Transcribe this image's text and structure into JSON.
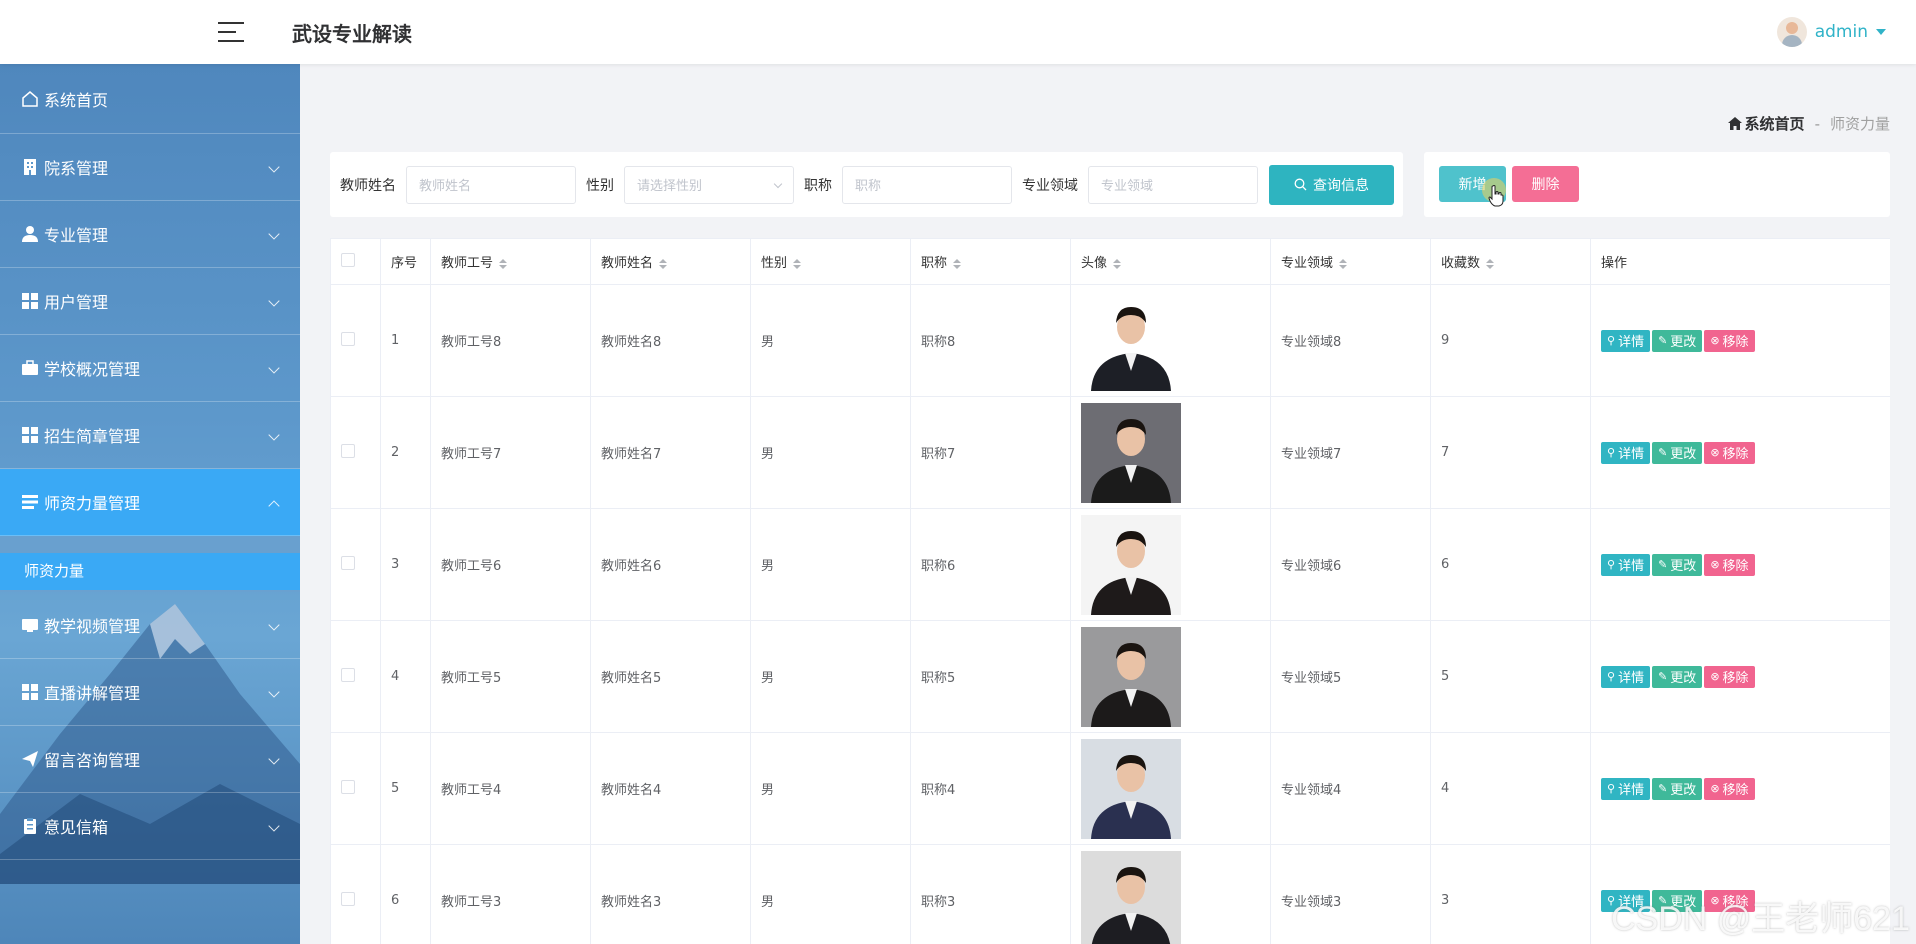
{
  "app": {
    "title": "武设专业解读"
  },
  "user": {
    "name": "admin"
  },
  "sidebar": {
    "items": [
      {
        "label": "系统首页",
        "icon": "home-icon",
        "expandable": false
      },
      {
        "label": "院系管理",
        "icon": "building-icon",
        "expandable": true
      },
      {
        "label": "专业管理",
        "icon": "user-icon",
        "expandable": true
      },
      {
        "label": "用户管理",
        "icon": "grid-icon",
        "expandable": true
      },
      {
        "label": "学校概况管理",
        "icon": "briefcase-icon",
        "expandable": true
      },
      {
        "label": "招生简章管理",
        "icon": "grid-icon",
        "expandable": true
      },
      {
        "label": "师资力量管理",
        "icon": "list-icon",
        "expandable": true,
        "active": true
      },
      {
        "label": "教学视频管理",
        "icon": "video-icon",
        "expandable": true
      },
      {
        "label": "直播讲解管理",
        "icon": "grid-icon",
        "expandable": true
      },
      {
        "label": "留言咨询管理",
        "icon": "send-icon",
        "expandable": true
      },
      {
        "label": "意见信箱",
        "icon": "clipboard-icon",
        "expandable": true
      }
    ],
    "submenu": {
      "label": "师资力量"
    }
  },
  "breadcrumb": {
    "home": "系统首页",
    "separator": "-",
    "current": "师资力量"
  },
  "search": {
    "teacher_name_label": "教师姓名",
    "teacher_name_placeholder": "教师姓名",
    "gender_label": "性别",
    "gender_placeholder": "请选择性别",
    "title_label": "职称",
    "title_placeholder": "职称",
    "field_label": "专业领域",
    "field_placeholder": "专业领域",
    "query_button": "查询信息"
  },
  "actions": {
    "add": "新增",
    "delete": "删除"
  },
  "table": {
    "headers": [
      "序号",
      "教师工号",
      "教师姓名",
      "性别",
      "职称",
      "头像",
      "专业领域",
      "收藏数",
      "操作"
    ],
    "op_labels": {
      "detail": "详情",
      "edit": "更改",
      "remove": "移除"
    },
    "rows": [
      {
        "index": "1",
        "id": "教师工号8",
        "name": "教师姓名8",
        "gender": "男",
        "title": "职称8",
        "field": "专业领域8",
        "favorites": "9"
      },
      {
        "index": "2",
        "id": "教师工号7",
        "name": "教师姓名7",
        "gender": "男",
        "title": "职称7",
        "field": "专业领域7",
        "favorites": "7"
      },
      {
        "index": "3",
        "id": "教师工号6",
        "name": "教师姓名6",
        "gender": "男",
        "title": "职称6",
        "field": "专业领域6",
        "favorites": "6"
      },
      {
        "index": "4",
        "id": "教师工号5",
        "name": "教师姓名5",
        "gender": "男",
        "title": "职称5",
        "field": "专业领域5",
        "favorites": "5"
      },
      {
        "index": "5",
        "id": "教师工号4",
        "name": "教师姓名4",
        "gender": "男",
        "title": "职称4",
        "field": "专业领域4",
        "favorites": "4"
      },
      {
        "index": "6",
        "id": "教师工号3",
        "name": "教师姓名3",
        "gender": "男",
        "title": "职称3",
        "field": "专业领域3",
        "favorites": "3"
      }
    ]
  },
  "watermark": "CSDN @王老师621",
  "colors": {
    "accent": "#2eb4c0",
    "danger": "#f46e95",
    "sidebar_active": "#3aa9f5",
    "edit": "#3fb99a"
  }
}
